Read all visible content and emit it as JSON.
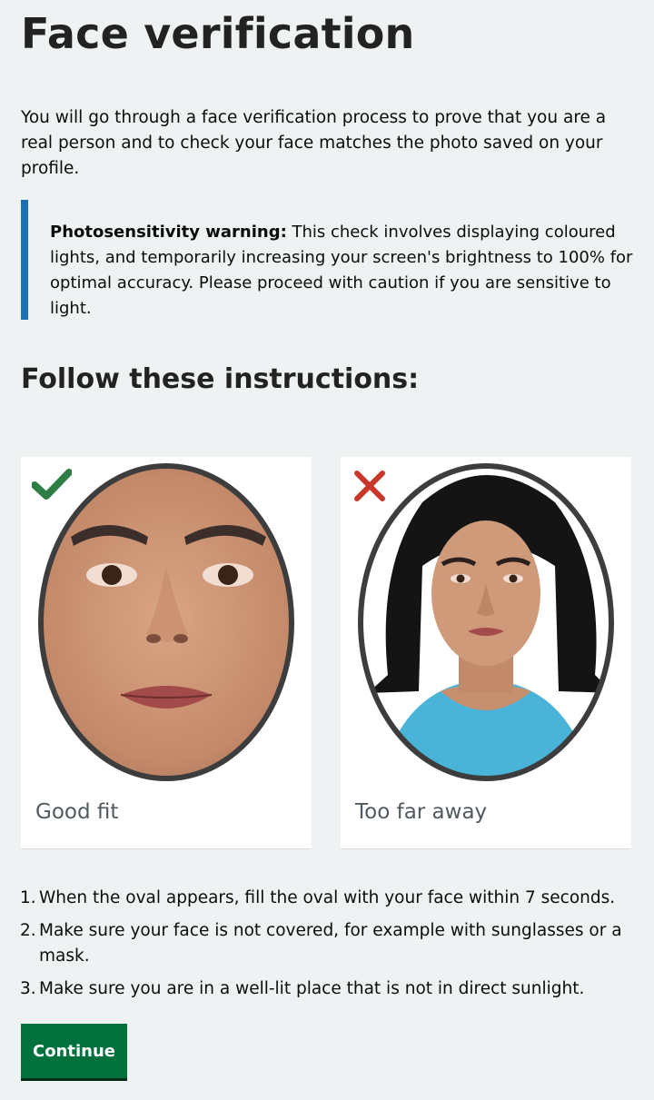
{
  "page": {
    "title": "Face verification",
    "intro": "You will go through a face verification process to prove that you are a real person and to check your face matches the photo saved on your profile."
  },
  "warning": {
    "label": "Photosensitivity warning:",
    "text": " This check involves displaying coloured lights, and temporarily increasing your screen's brightness to 100% for optimal accuracy. Please proceed with caution if you are sensitive to light.",
    "accent_color": "#1d70b8"
  },
  "instructions": {
    "heading": "Follow these instructions:",
    "examples": [
      {
        "caption": "Good fit",
        "status": "correct",
        "icon": "checkmark-icon",
        "color": "#2e7d45"
      },
      {
        "caption": "Too far away",
        "status": "incorrect",
        "icon": "cross-icon",
        "color": "#c8362c"
      }
    ],
    "steps": [
      {
        "number": "1.",
        "text": "When the oval appears, fill the oval with your face within 7 seconds."
      },
      {
        "number": "2.",
        "text": "Make sure your face is not covered, for example with sunglasses or a mask."
      },
      {
        "number": "3.",
        "text": "Make sure you are in a well-lit place that is not in direct sunlight."
      }
    ]
  },
  "actions": {
    "continue_label": "Continue",
    "button_color": "#00703c"
  }
}
